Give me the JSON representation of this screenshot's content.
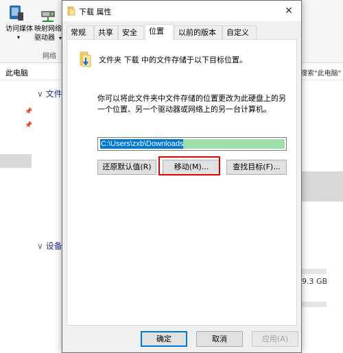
{
  "explorer": {
    "ribbon": {
      "access_media": "访问媒体",
      "map_network_line1": "映射网络",
      "map_network_line2": "驱动器",
      "group_network": "网络"
    },
    "address_left": "此电脑",
    "address_right_search": "搜索\"此电脑\"",
    "section_folders": "文件",
    "section_devices": "设备",
    "drive_size": "9.3 GB"
  },
  "dialog": {
    "title": "下载 属性",
    "tabs": [
      "常规",
      "共享",
      "安全",
      "位置",
      "以前的版本",
      "自定义"
    ],
    "active_tab": "位置",
    "heading": "文件夹 下载 中的文件存储于以下目标位置。",
    "description": "你可以将此文件夹中文件存储的位置更改为此硬盘上的另一个位置、另一个驱动器或网络上的另一台计算机。",
    "path_value": "C:\\Users\\zxb\\Downloads",
    "buttons": {
      "restore_default": "还原默认值(R)",
      "move": "移动(M)...",
      "find_target": "查找目标(F)..."
    },
    "footer": {
      "ok": "确定",
      "cancel": "取消",
      "apply": "应用(A)"
    }
  },
  "colors": {
    "highlight_border": "#e00000",
    "selection": "#0078d7"
  }
}
